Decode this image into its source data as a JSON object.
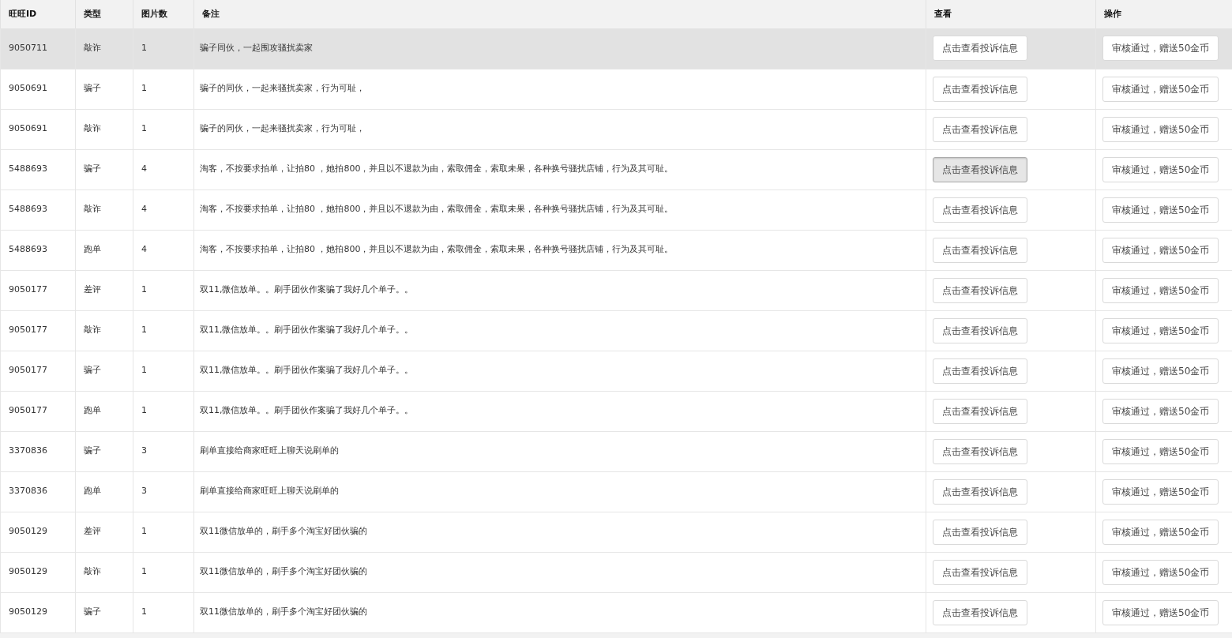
{
  "table": {
    "columns": [
      "旺旺ID",
      "类型",
      "图片数",
      "备注",
      "查看",
      "操作"
    ],
    "rows": [
      {
        "id": "9050711",
        "type": "敲诈",
        "images": "1",
        "note": "骗子同伙，一起围攻骚扰卖家",
        "view": "点击查看投诉信息",
        "action": "审核通过，赠送50金币",
        "selected": true,
        "view_pressed": false
      },
      {
        "id": "9050691",
        "type": "骗子",
        "images": "1",
        "note": "骗子的同伙，一起来骚扰卖家，行为可耻，",
        "view": "点击查看投诉信息",
        "action": "审核通过，赠送50金币",
        "selected": false,
        "view_pressed": false
      },
      {
        "id": "9050691",
        "type": "敲诈",
        "images": "1",
        "note": "骗子的同伙，一起来骚扰卖家，行为可耻，",
        "view": "点击查看投诉信息",
        "action": "审核通过，赠送50金币",
        "selected": false,
        "view_pressed": false
      },
      {
        "id": "5488693",
        "type": "骗子",
        "images": "4",
        "note": "淘客，不按要求拍单，让拍80 ，她拍800，并且以不退款为由，索取佣金，索取未果，各种换号骚扰店铺，行为及其可耻。",
        "view": "点击查看投诉信息",
        "action": "审核通过，赠送50金币",
        "selected": false,
        "view_pressed": true
      },
      {
        "id": "5488693",
        "type": "敲诈",
        "images": "4",
        "note": "淘客，不按要求拍单，让拍80 ，她拍800，并且以不退款为由，索取佣金，索取未果，各种换号骚扰店铺，行为及其可耻。",
        "view": "点击查看投诉信息",
        "action": "审核通过，赠送50金币",
        "selected": false,
        "view_pressed": false
      },
      {
        "id": "5488693",
        "type": "跑单",
        "images": "4",
        "note": "淘客，不按要求拍单，让拍80 ，她拍800，并且以不退款为由，索取佣金，索取未果，各种换号骚扰店铺，行为及其可耻。",
        "view": "点击查看投诉信息",
        "action": "审核通过，赠送50金币",
        "selected": false,
        "view_pressed": false
      },
      {
        "id": "9050177",
        "type": "差评",
        "images": "1",
        "note": "双11,微信放单。。刷手团伙作案骗了我好几个单子。。",
        "view": "点击查看投诉信息",
        "action": "审核通过，赠送50金币",
        "selected": false,
        "view_pressed": false
      },
      {
        "id": "9050177",
        "type": "敲诈",
        "images": "1",
        "note": "双11,微信放单。。刷手团伙作案骗了我好几个单子。。",
        "view": "点击查看投诉信息",
        "action": "审核通过，赠送50金币",
        "selected": false,
        "view_pressed": false
      },
      {
        "id": "9050177",
        "type": "骗子",
        "images": "1",
        "note": "双11,微信放单。。刷手团伙作案骗了我好几个单子。。",
        "view": "点击查看投诉信息",
        "action": "审核通过，赠送50金币",
        "selected": false,
        "view_pressed": false
      },
      {
        "id": "9050177",
        "type": "跑单",
        "images": "1",
        "note": "双11,微信放单。。刷手团伙作案骗了我好几个单子。。",
        "view": "点击查看投诉信息",
        "action": "审核通过，赠送50金币",
        "selected": false,
        "view_pressed": false
      },
      {
        "id": "3370836",
        "type": "骗子",
        "images": "3",
        "note": "刷单直接给商家旺旺上聊天说刷单的",
        "view": "点击查看投诉信息",
        "action": "审核通过，赠送50金币",
        "selected": false,
        "view_pressed": false
      },
      {
        "id": "3370836",
        "type": "跑单",
        "images": "3",
        "note": "刷单直接给商家旺旺上聊天说刷单的",
        "view": "点击查看投诉信息",
        "action": "审核通过，赠送50金币",
        "selected": false,
        "view_pressed": false
      },
      {
        "id": "9050129",
        "type": "差评",
        "images": "1",
        "note": "双11微信放单的，刷手多个淘宝好团伙骗的",
        "view": "点击查看投诉信息",
        "action": "审核通过，赠送50金币",
        "selected": false,
        "view_pressed": false
      },
      {
        "id": "9050129",
        "type": "敲诈",
        "images": "1",
        "note": "双11微信放单的，刷手多个淘宝好团伙骗的",
        "view": "点击查看投诉信息",
        "action": "审核通过，赠送50金币",
        "selected": false,
        "view_pressed": false
      },
      {
        "id": "9050129",
        "type": "骗子",
        "images": "1",
        "note": "双11微信放单的，刷手多个淘宝好团伙骗的",
        "view": "点击查看投诉信息",
        "action": "审核通过，赠送50金币",
        "selected": false,
        "view_pressed": false
      }
    ]
  }
}
